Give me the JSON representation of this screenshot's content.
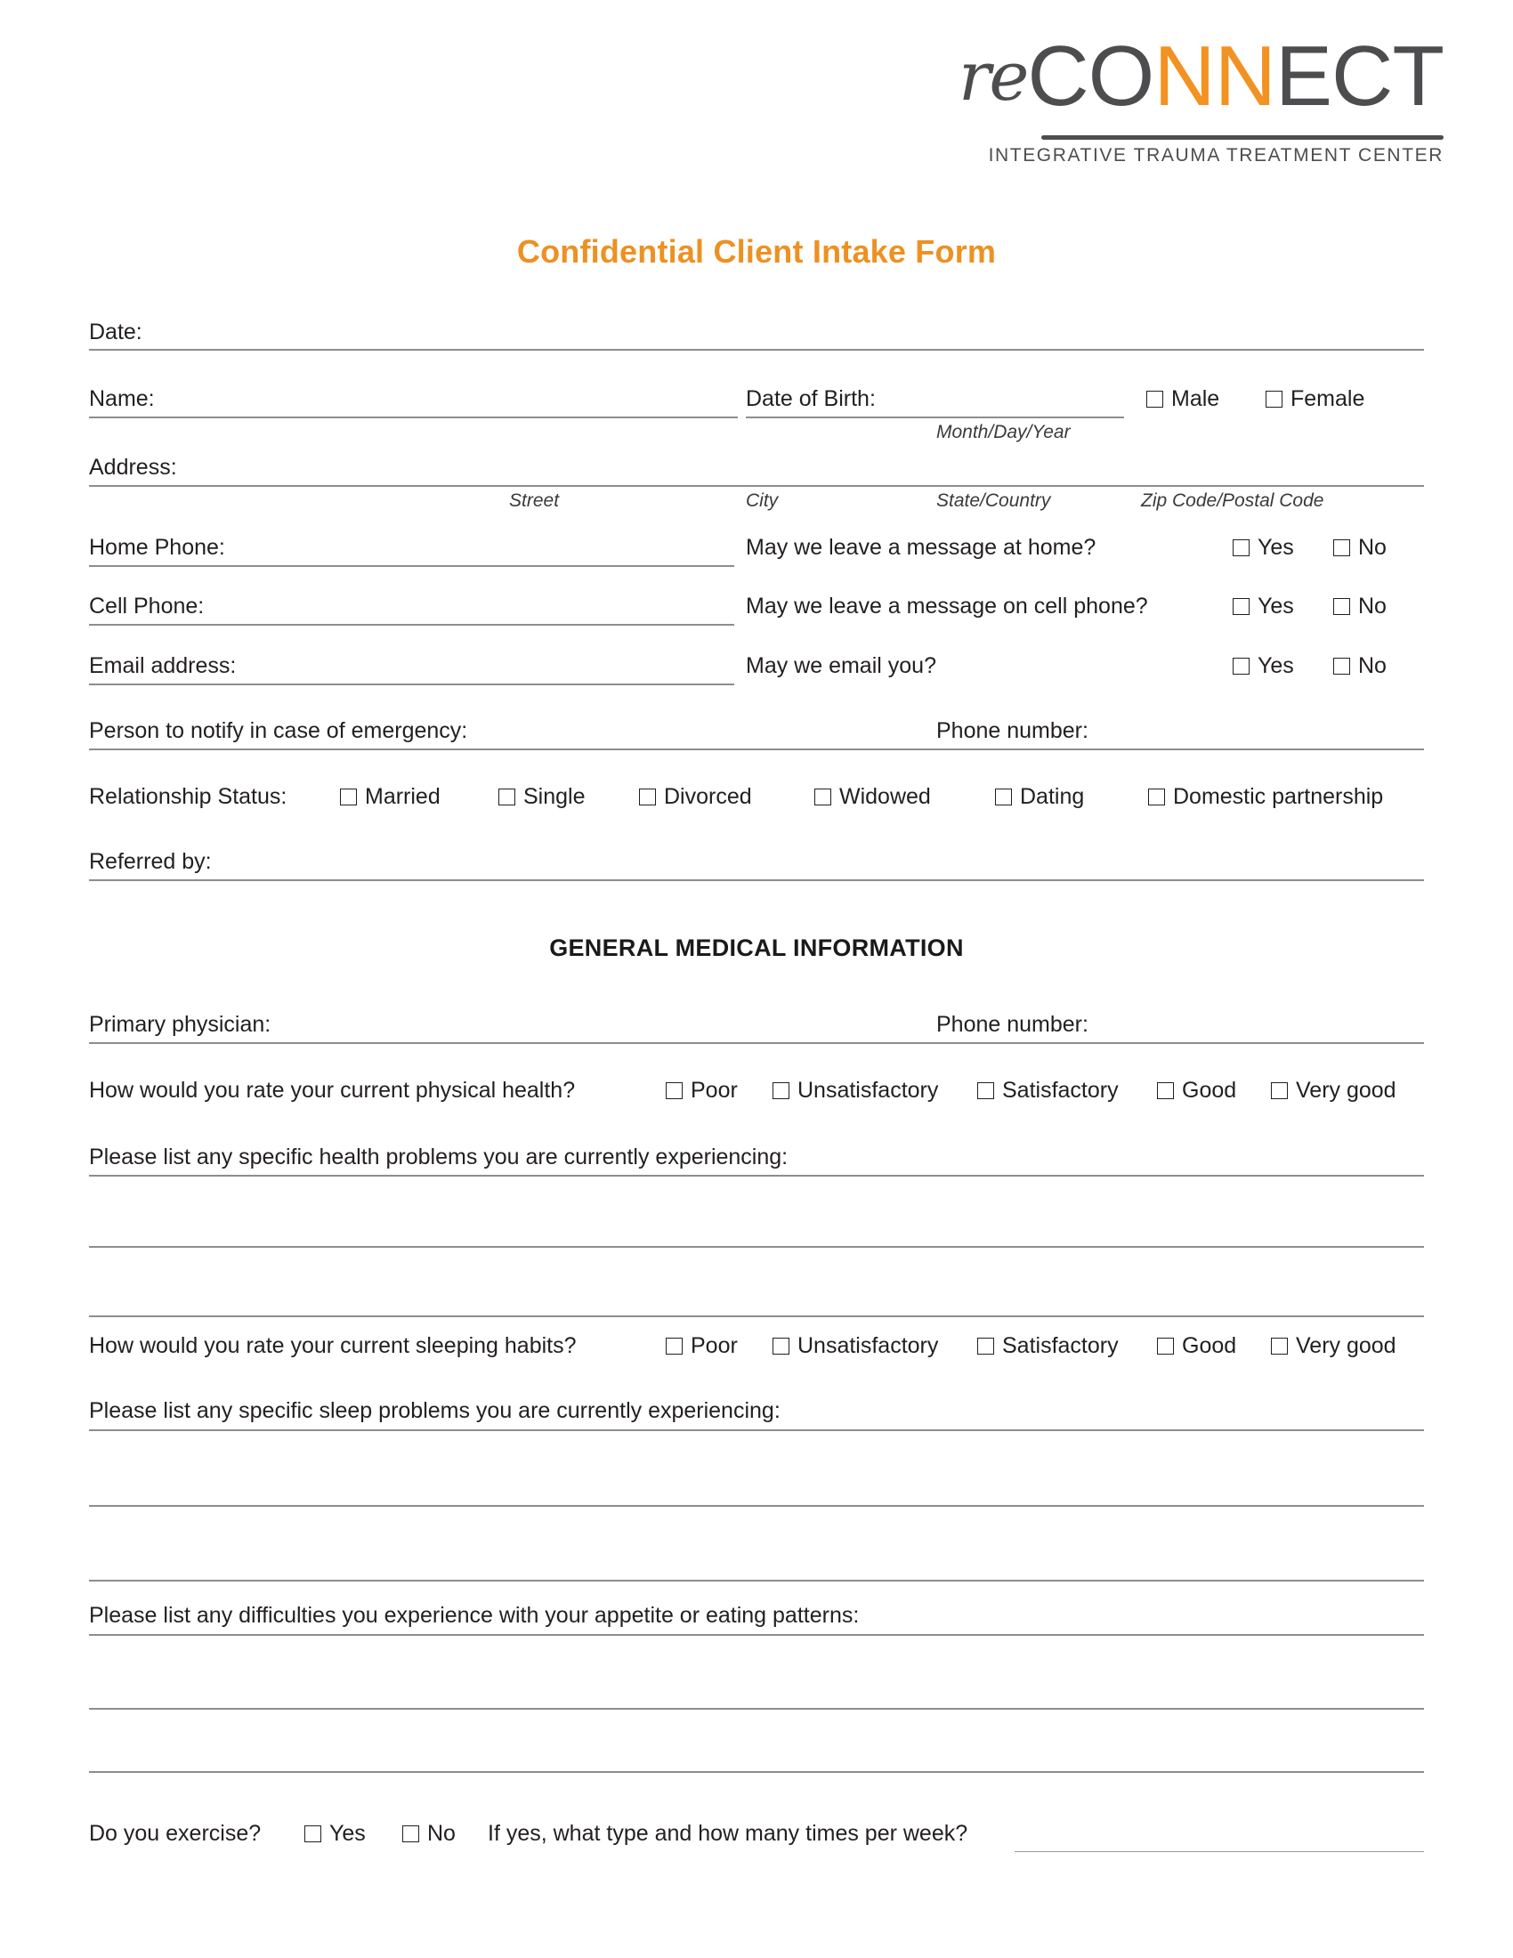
{
  "logo": {
    "script_part": "re",
    "dark_part_1": "CO",
    "orange_part": "NN",
    "dark_part_2": "ECT",
    "tagline": "INTEGRATIVE TRAUMA TREATMENT CENTER",
    "orange_hex": "#f29222",
    "dark_hex": "#4d4d4f"
  },
  "title": "Confidential Client Intake Form",
  "title_color": "#ed9122",
  "fields": {
    "date": "Date:",
    "name": "Name:",
    "dob": "Date of Birth:",
    "dob_sub": "Month/Day/Year",
    "address": "Address:",
    "address_sub_street": "Street",
    "address_sub_city": "City",
    "address_sub_state": "State/Country",
    "address_sub_zip": "Zip Code/Postal Code",
    "home_phone": "Home Phone:",
    "cell_phone": "Cell Phone:",
    "email": "Email address:",
    "emergency_contact": "Person to notify in case of emergency:",
    "emergency_phone": "Phone number:",
    "relationship_status": "Relationship  Status:",
    "referred_by": "Referred by:",
    "primary_physician": "Primary physician:",
    "physician_phone": "Phone number:"
  },
  "gender_options": [
    "Male",
    "Female"
  ],
  "yesno": [
    "Yes",
    "No"
  ],
  "message_questions": [
    "May we leave a message at home?",
    "May we leave a message on cell phone?",
    "May we email you?"
  ],
  "relationship_options": [
    "Married",
    "Single",
    "Divorced",
    "Widowed",
    "Dating",
    "Domestic partnership"
  ],
  "section_heading": "GENERAL MEDICAL INFORMATION",
  "rating_options": [
    "Poor",
    "Unsatisfactory",
    "Satisfactory",
    "Good",
    "Very good"
  ],
  "questions": {
    "physical_health": "How would you rate your current physical health?",
    "health_problems": "Please list any specific health problems you are currently experiencing:",
    "sleeping_habits": "How would you rate your current sleeping habits?",
    "sleep_problems": "Please list any specific sleep problems you are currently experiencing:",
    "appetite": "Please list any difficulties you experience with your appetite or eating patterns:",
    "exercise": "Do you exercise?",
    "exercise_followup": "If yes, what type and how many times per week?"
  }
}
